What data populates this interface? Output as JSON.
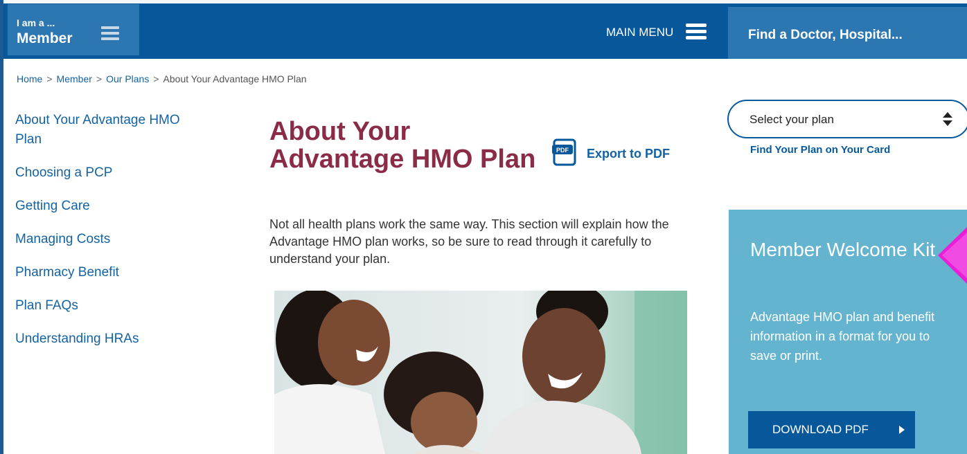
{
  "header": {
    "member_small": "I am a ...",
    "member_big": "Member",
    "main_menu_label": "MAIN MENU",
    "find_label": "Find a Doctor, Hospital..."
  },
  "breadcrumb": {
    "items": [
      "Home",
      "Member",
      "Our Plans"
    ],
    "separator": ">",
    "current": "About Your Advantage HMO Plan"
  },
  "left_nav": {
    "items": [
      "About Your Advantage HMO Plan",
      "Choosing a PCP",
      "Getting Care",
      "Managing Costs",
      "Pharmacy Benefit",
      "Plan FAQs",
      "Understanding HRAs"
    ]
  },
  "main": {
    "title": "About Your Advantage HMO Plan",
    "export_label": "Export to PDF",
    "pdf_icon_text": "PDF",
    "intro": "Not all health plans work the same way. This section will explain how the Advantage HMO plan works, so be sure to read through it carefully to understand your plan."
  },
  "right_rail": {
    "plan_select_label": "Select your plan",
    "find_plan_link": "Find Your Plan on Your Card",
    "welcome_title": "Member Welcome Kit",
    "welcome_text": "Advantage HMO plan and benefit information in a format for you to save or print.",
    "download_label": "DOWNLOAD PDF"
  },
  "icons": {
    "member_menu": "hamburger-icon",
    "main_menu": "hamburger-icon",
    "pdf": "pdf-document-icon",
    "select": "updown-arrows-icon",
    "download": "caret-right-icon"
  },
  "colors": {
    "header": "#06589a",
    "accent_box": "#2c76b1",
    "title": "#8b2c47",
    "link": "#1462a2",
    "welcome": "#64b4cf",
    "marker": "#e81fd6"
  }
}
